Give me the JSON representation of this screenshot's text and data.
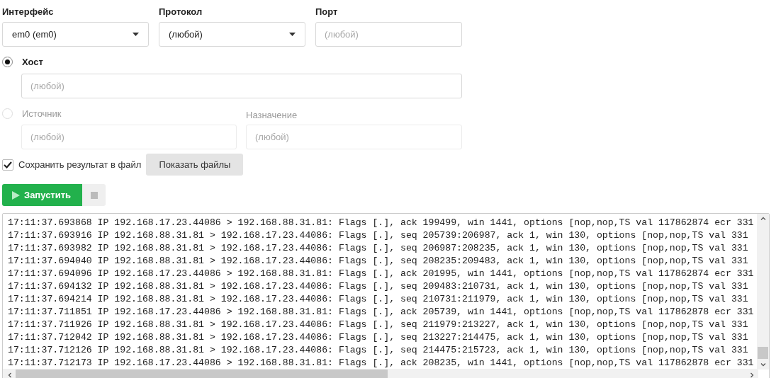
{
  "filters": [
    {
      "kind": "select",
      "label": "Интерфейс",
      "value": "em0 (em0)"
    },
    {
      "kind": "select",
      "label": "Протокол",
      "value": "(любой)"
    },
    {
      "kind": "input",
      "label": "Порт",
      "placeholder": "(любой)"
    }
  ],
  "address_modes": [
    {
      "kind": "single",
      "label": "Хост",
      "selected": true,
      "fields": [
        {
          "placeholder": "(любой)"
        }
      ]
    },
    {
      "kind": "pair",
      "label": "Источник",
      "selected": false,
      "fields": [
        {
          "placeholder": "(любой)"
        },
        {
          "label": "Назначение",
          "placeholder": "(любой)"
        }
      ]
    }
  ],
  "save_to_file": {
    "label": "Сохранить результат в файл",
    "checked": true
  },
  "show_files_button": "Показать файлы",
  "run_button": "Запустить",
  "log": [
    "17:11:37.693868 IP 192.168.17.23.44086 > 192.168.88.31.81: Flags [.], ack 199499, win 1441, options [nop,nop,TS val 117862874 ecr 331",
    "17:11:37.693916 IP 192.168.88.31.81 > 192.168.17.23.44086: Flags [.], seq 205739:206987, ack 1, win 130, options [nop,nop,TS val 331",
    "17:11:37.693982 IP 192.168.88.31.81 > 192.168.17.23.44086: Flags [.], seq 206987:208235, ack 1, win 130, options [nop,nop,TS val 331",
    "17:11:37.694040 IP 192.168.88.31.81 > 192.168.17.23.44086: Flags [.], seq 208235:209483, ack 1, win 130, options [nop,nop,TS val 331",
    "17:11:37.694096 IP 192.168.17.23.44086 > 192.168.88.31.81: Flags [.], ack 201995, win 1441, options [nop,nop,TS val 117862874 ecr 331",
    "17:11:37.694132 IP 192.168.88.31.81 > 192.168.17.23.44086: Flags [.], seq 209483:210731, ack 1, win 130, options [nop,nop,TS val 331",
    "17:11:37.694214 IP 192.168.88.31.81 > 192.168.17.23.44086: Flags [.], seq 210731:211979, ack 1, win 130, options [nop,nop,TS val 331",
    "17:11:37.711851 IP 192.168.17.23.44086 > 192.168.88.31.81: Flags [.], ack 205739, win 1441, options [nop,nop,TS val 117862878 ecr 331",
    "17:11:37.711926 IP 192.168.88.31.81 > 192.168.17.23.44086: Flags [.], seq 211979:213227, ack 1, win 130, options [nop,nop,TS val 331",
    "17:11:37.712042 IP 192.168.88.31.81 > 192.168.17.23.44086: Flags [.], seq 213227:214475, ack 1, win 130, options [nop,nop,TS val 331",
    "17:11:37.712126 IP 192.168.88.31.81 > 192.168.17.23.44086: Flags [.], seq 214475:215723, ack 1, win 130, options [nop,nop,TS val 331",
    "17:11:37.712173 IP 192.168.17.23.44086 > 192.168.88.31.81: Flags [.], ack 208235, win 1441, options [nop,nop,TS val 117862878 ecr 331"
  ]
}
